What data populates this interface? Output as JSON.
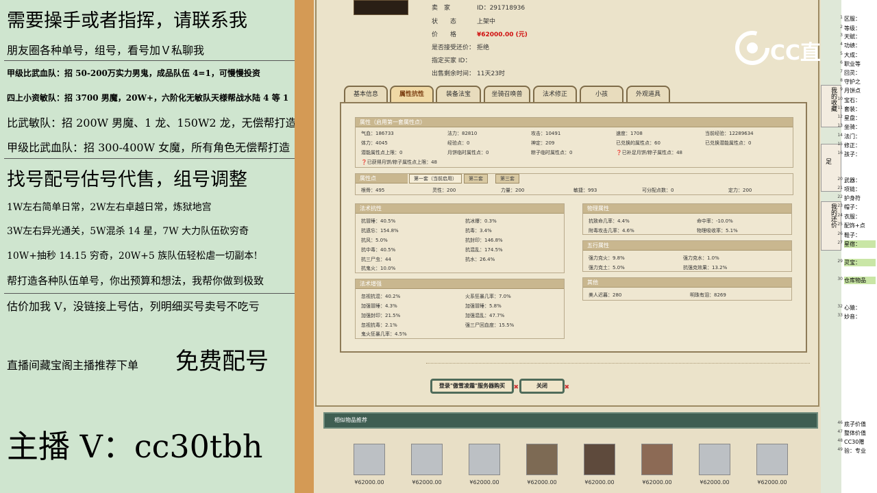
{
  "promo": {
    "l1": "需要操手或者指挥，请联系我",
    "l2": "朋友圈各种单号，组号，看号加Ｖ私聊我",
    "l3": "甲级比武血队：招 50-200万实力男鬼，成品队伍 4=1，可慢慢投资",
    "l4": "四上小资敏队：招 3700 男魔，20W+，六阶化无敏队天様帮战水陆 4 等 1",
    "l5": "比武敏队：招 200W 男魔、1 龙、150W2 龙，无偿帮打造",
    "l6": "甲级比武血队：招 300-400W 女魔，所有角色无偿帮打造",
    "l7": "找号配号估号代售，组号调整",
    "l8": "1W左右简单日常，2W左右卓越日常，炼狱地宫",
    "l9": "3W左右异光通关，5W混杀 14 星，7W 大力队伍砍穷奇",
    "l10": "10W+抽秒 14.15 穷奇，20W+5 族队伍轻松虐一切副本!",
    "l11": "帮打造各种队伍单号，你出预算和想法，我帮你做到极致",
    "l12": "估价加我 V，没链接上号估，列明细买号卖号不吃亏",
    "l13a": "直播间藏宝阁主播推荐下单",
    "l13b": "免费配号",
    "l14": "主播 V：cc30tbh"
  },
  "info": [
    {
      "k": "卖　家",
      "v": "ID：291718936"
    },
    {
      "k": "状　　态",
      "v": "上架中"
    },
    {
      "k": "价　　格",
      "v": "¥62000.00 (元)"
    },
    {
      "k": "是否接受还价：",
      "v": "拒绝"
    },
    {
      "k": "指定买家 ID：",
      "v": ""
    },
    {
      "k": "出售剩余时间：",
      "v": "11天23时"
    }
  ],
  "tabs": [
    "基本信息",
    "属性抗性",
    "装备法宝",
    "坐骑召唤兽",
    "法术修正",
    "小孩",
    "外观道具"
  ],
  "attr": {
    "header": "属性（启用第一套属性点）",
    "cells": [
      "气血：186733",
      "法力：82810",
      "攻击：10491",
      "速度：1708",
      "当前经验：12289634",
      "体力：4045",
      "经验点：0",
      "神定：209",
      "已兑换的属性点：60",
      "已兑换潜能属性点：0",
      "潜能属性点上限：0",
      "月饼临时属性点：0",
      "粽子临时属性点：0",
      "已补足月饼/粽子属性点：48"
    ],
    "note": "已获得月饼/粽子属性点上限：48"
  },
  "points": {
    "header": "属性点",
    "subtabs": [
      "第一套（当前启用）",
      "第二套",
      "第三套"
    ],
    "cells": [
      "根骨：495",
      "灵性：200",
      "力量：200",
      "敏捷：993",
      "可分配点数：0",
      "定力：200"
    ]
  },
  "resist": {
    "header": "法术抗性",
    "cells": [
      "抗冒睡：40.5%",
      "抗冰爆：0.3%",
      "抗遗忘：154.8%",
      "抗毒：3.4%",
      "抗风：5.0%",
      "抗封印：146.8%",
      "抗中毒：40.5%",
      "抗混乱：174.5%",
      "抗三尸虫：44",
      "抗水：26.4%",
      "抗鬼火：10.0%"
    ]
  },
  "boost": {
    "header": "法术增强",
    "cells": [
      "忽视抗混：40.2%",
      "火系狂暴几率：7.0%",
      "加强冒睡：4.3%",
      "加强冒睡：5.8%",
      "加强封印：21.5%",
      "加强混乱：47.7%",
      "忽视抗毒：2.1%",
      "强三尸回血度：15.5%",
      "鬼火狂暴几率：4.5%"
    ]
  },
  "phys": {
    "header": "物理属性",
    "cells": [
      "抗致命几率：4.4%",
      "命中率：-10.0%",
      "附毒攻击几率：4.6%",
      "物理吸收率：5.1%"
    ]
  },
  "five": {
    "header": "五行属性",
    "cells": [
      "强力克火：9.8%",
      "强力克水：1.0%",
      "强力克土：5.0%",
      "抗强克效果：13.2%"
    ]
  },
  "other": {
    "header": "其他",
    "cells": [
      "美人迟暮：280",
      "明珠有泪：8269"
    ]
  },
  "buttons": {
    "login": "登录\"傲雪凌霜\"服务器购买",
    "close": "关闭"
  },
  "rec": {
    "header": "相似物品推荐",
    "prices": [
      "¥62000.00",
      "¥62000.00",
      "¥62000.00",
      "¥62000.00",
      "¥62000.00",
      "¥62000.00",
      "¥62000.00",
      "¥62000.00"
    ]
  },
  "logo": "CC直播",
  "sheet": {
    "rows": [
      [
        "1",
        "区服："
      ],
      [
        "2",
        "等级："
      ],
      [
        "3",
        "天赋："
      ],
      [
        "4",
        "功绩："
      ],
      [
        "5",
        "大成："
      ],
      [
        "6",
        "职业等"
      ],
      [
        "7",
        "回灵："
      ],
      [
        "8",
        "守护之"
      ],
      [
        "9",
        "月饼点"
      ],
      [
        "10",
        "宝石："
      ],
      [
        "11",
        "套装："
      ],
      [
        "12",
        "星盘："
      ],
      [
        "13",
        "坐骑："
      ],
      [
        "14",
        "法门："
      ],
      [
        "15",
        "修正："
      ],
      [
        "16",
        "孩子："
      ],
      [
        "20",
        "武器："
      ],
      [
        "21",
        "项链："
      ],
      [
        "22",
        "护身符"
      ],
      [
        "23",
        "帽子："
      ],
      [
        "24",
        "衣服："
      ],
      [
        "25",
        "配饰+点"
      ],
      [
        "26",
        "鞋子："
      ],
      [
        "27",
        "星宿："
      ],
      [
        "29",
        "灵宝："
      ],
      [
        "30",
        "仓库物品"
      ],
      [
        "32",
        "心猿："
      ],
      [
        "33",
        "妙音："
      ],
      [
        "46",
        "底子价值"
      ],
      [
        "47",
        "整体价值"
      ],
      [
        "48",
        "CC30赠"
      ],
      [
        "49",
        "验：专业"
      ]
    ],
    "side": [
      "我的收藏",
      "足",
      "我的还价"
    ]
  }
}
